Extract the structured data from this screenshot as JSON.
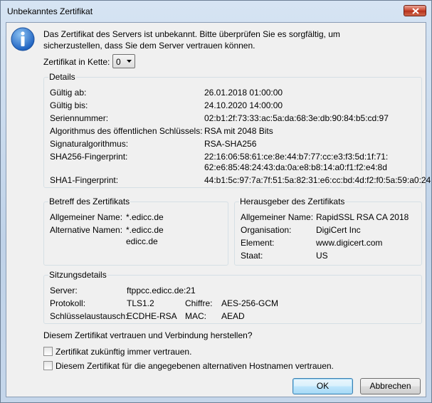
{
  "window": {
    "title": "Unbekanntes Zertifikat"
  },
  "message": "Das Zertifikat des Servers ist unbekannt. Bitte überprüfen Sie es sorgfältig, um sicherzustellen, dass Sie dem Server vertrauen können.",
  "chain": {
    "label": "Zertifikat in Kette:",
    "value": "0"
  },
  "details": {
    "title": "Details",
    "rows": [
      {
        "label": "Gültig ab:",
        "value": "26.01.2018 01:00:00"
      },
      {
        "label": "Gültig bis:",
        "value": "24.10.2020 14:00:00"
      },
      {
        "label": "Seriennummer:",
        "value": "02:b1:2f:73:33:ac:5a:da:68:3e:db:90:84:b5:cd:97"
      },
      {
        "label": "Algorithmus des öffentlichen Schlüssels:",
        "value": "RSA mit 2048 Bits"
      },
      {
        "label": "Signaturalgorithmus:",
        "value": "RSA-SHA256"
      },
      {
        "label": "SHA256-Fingerprint:",
        "value": "22:16:06:58:61:ce:8e:44:b7:77:cc:e3:f3:5d:1f:71:",
        "value2": "62:e6:85:48:24:43:da:0a:e8:b8:14:a0:f1:f2:e4:8d"
      },
      {
        "label": "SHA1-Fingerprint:",
        "value": "44:b1:5c:97:7a:7f:51:5a:82:31:e6:cc:bd:4d:f2:f0:5a:59:a0:24"
      }
    ]
  },
  "subject": {
    "title": "Betreff des Zertifikats",
    "common_name_label": "Allgemeiner Name:",
    "common_name": "*.edicc.de",
    "alt_names_label": "Alternative Namen:",
    "alt_names": [
      "*.edicc.de",
      "edicc.de"
    ]
  },
  "issuer": {
    "title": "Herausgeber des Zertifikats",
    "rows": [
      {
        "label": "Allgemeiner Name:",
        "value": "RapidSSL RSA CA 2018"
      },
      {
        "label": "Organisation:",
        "value": "DigiCert Inc"
      },
      {
        "label": "Element:",
        "value": "www.digicert.com"
      },
      {
        "label": "Staat:",
        "value": "US"
      }
    ]
  },
  "session": {
    "title": "Sitzungsdetails",
    "server_label": "Server:",
    "server": "ftppcc.edicc.de:21",
    "protocol_label": "Protokoll:",
    "protocol": "TLS1.2",
    "cipher_label": "Chiffre:",
    "cipher": "AES-256-GCM",
    "kex_label": "Schlüsselaustausch:",
    "kex": "ECDHE-RSA",
    "mac_label": "MAC:",
    "mac": "AEAD"
  },
  "trust": {
    "question": "Diesem Zertifikat vertrauen und Verbindung herstellen?",
    "always_label": "Zertifikat zukünftig immer vertrauen.",
    "alt_hosts_label": "Diesem Zertifikat für die angegebenen alternativen Hostnamen vertrauen."
  },
  "buttons": {
    "ok": "OK",
    "cancel": "Abbrechen"
  },
  "colors": {
    "accent": "#1b5fbf",
    "close": "#c9432a"
  },
  "icons": {
    "info": "info-icon",
    "close": "close-icon",
    "dropdown": "chevron-down-icon"
  }
}
